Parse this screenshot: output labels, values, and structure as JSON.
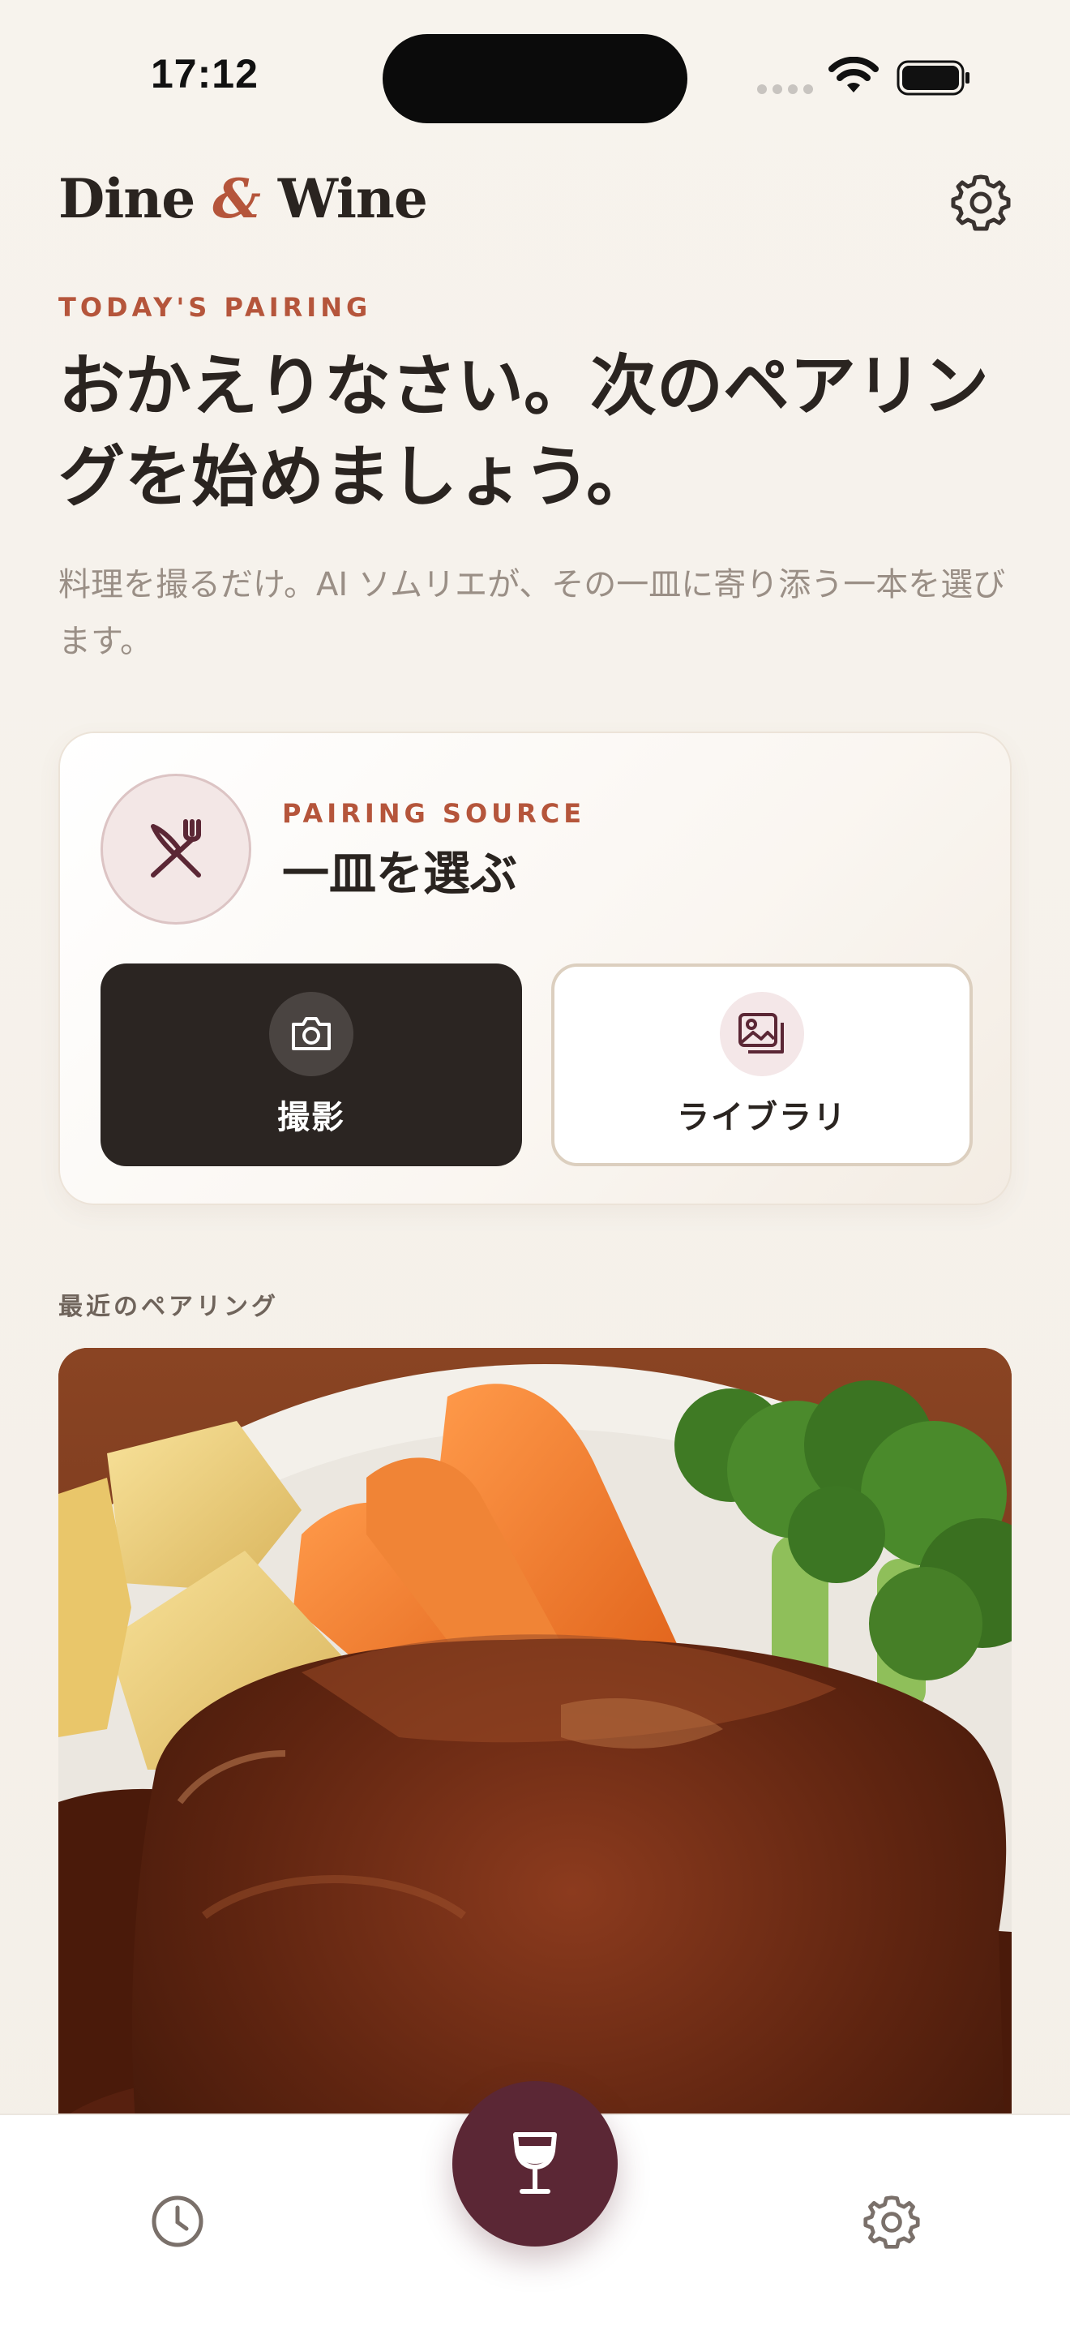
{
  "status_bar": {
    "time": "17:12"
  },
  "header": {
    "logo_left": "Dine",
    "logo_amp": "&",
    "logo_right": "Wine",
    "settings_icon": "gear-icon"
  },
  "hero": {
    "kicker": "TODAY'S PAIRING",
    "headline": "おかえりなさい。次のペアリングを始めましょう。",
    "subcopy": "料理を撮るだけ。AI ソムリエが、その一皿に寄り添う一本を選びます。"
  },
  "pairing_card": {
    "icon": "fork-knife-icon",
    "kicker": "PAIRING SOURCE",
    "title": "一皿を選ぶ",
    "camera_button": {
      "label": "撮影",
      "icon": "camera-icon"
    },
    "library_button": {
      "label": "ライブラリ",
      "icon": "photo-library-icon"
    }
  },
  "recent": {
    "section_label": "最近のペアリング"
  },
  "tab_bar": {
    "history_icon": "clock-icon",
    "center_icon": "wine-glass-icon",
    "settings_icon": "gear-icon"
  },
  "colors": {
    "accent": "#b5553b",
    "wine": "#5b2735",
    "dark_button": "#2b2522",
    "background": "#f6f2ec"
  }
}
